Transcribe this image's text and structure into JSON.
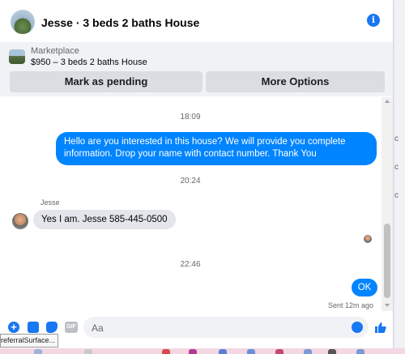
{
  "header": {
    "title": "Jesse · 3 beds 2 baths House",
    "info_icon": "i"
  },
  "marketplace": {
    "category": "Marketplace",
    "listing": "$950 – 3 beds 2 baths House",
    "buttons": {
      "pending": "Mark as pending",
      "options": "More Options"
    }
  },
  "messages": {
    "time1": "18:09",
    "out1": "Hello are you interested in this house?  We will provide you complete information. Drop your name with contact number. Thank You",
    "time2": "20:24",
    "sender": "Jesse",
    "in1": "Yes I am. Jesse 585-445-0500",
    "time3": "22:46",
    "out2": "OK",
    "sent_status": "Sent 12m ago"
  },
  "composer": {
    "placeholder": "Aa",
    "gif_label": "GIF",
    "plus": "+"
  },
  "tooltip": "referralSurface..."
}
